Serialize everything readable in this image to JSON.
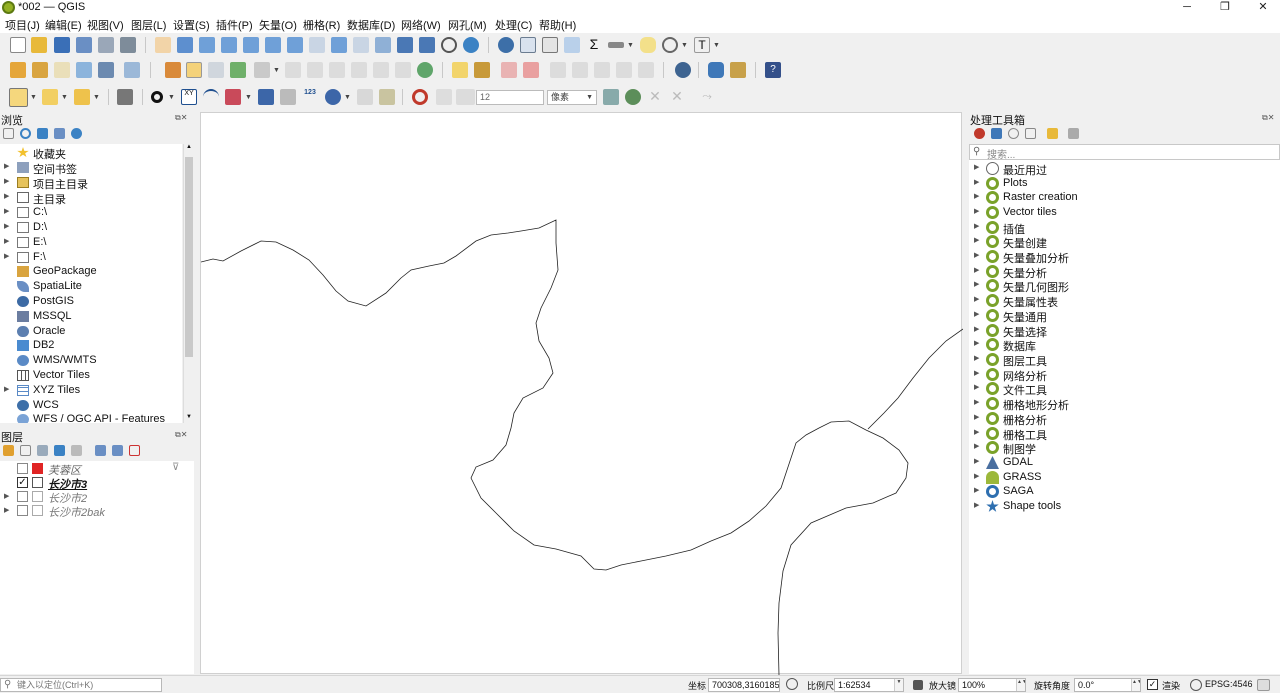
{
  "window": {
    "title": "*002 — QGIS",
    "minimize": "─",
    "maximize": "❐",
    "close": "✕"
  },
  "menu": [
    "项目(J)",
    "编辑(E)",
    "视图(V)",
    "图层(L)",
    "设置(S)",
    "插件(P)",
    "矢量(O)",
    "栅格(R)",
    "数据库(D)",
    "网络(W)",
    "网孔(M)",
    "处理(C)",
    "帮助(H)"
  ],
  "digitize": {
    "font_size": "12",
    "unit": "像素"
  },
  "browser": {
    "title": "浏览",
    "items": [
      {
        "label": "收藏夹",
        "icon": "star-icon",
        "arrow": false
      },
      {
        "label": "空间书签",
        "icon": "bookmark-icon",
        "arrow": true
      },
      {
        "label": "项目主目录",
        "icon": "project-folder-icon",
        "arrow": true
      },
      {
        "label": "主目录",
        "icon": "home-folder-icon",
        "arrow": true
      },
      {
        "label": "C:\\",
        "icon": "drive-icon",
        "arrow": true
      },
      {
        "label": "D:\\",
        "icon": "drive-icon",
        "arrow": true
      },
      {
        "label": "E:\\",
        "icon": "drive-icon",
        "arrow": true
      },
      {
        "label": "F:\\",
        "icon": "drive-icon",
        "arrow": true
      },
      {
        "label": "GeoPackage",
        "icon": "geopackage-icon",
        "arrow": false
      },
      {
        "label": "SpatiaLite",
        "icon": "spatialite-icon",
        "arrow": false
      },
      {
        "label": "PostGIS",
        "icon": "postgis-icon",
        "arrow": false
      },
      {
        "label": "MSSQL",
        "icon": "mssql-icon",
        "arrow": false
      },
      {
        "label": "Oracle",
        "icon": "oracle-icon",
        "arrow": false
      },
      {
        "label": "DB2",
        "icon": "db2-icon",
        "arrow": false
      },
      {
        "label": "WMS/WMTS",
        "icon": "wms-icon",
        "arrow": false
      },
      {
        "label": "Vector Tiles",
        "icon": "vector-tiles-icon",
        "arrow": false
      },
      {
        "label": "XYZ Tiles",
        "icon": "xyz-tiles-icon",
        "arrow": true
      },
      {
        "label": "WCS",
        "icon": "wcs-icon",
        "arrow": false
      },
      {
        "label": "WFS / OGC API - Features",
        "icon": "wfs-icon",
        "arrow": false
      }
    ]
  },
  "layers": {
    "title": "图层",
    "items": [
      {
        "label": "芙蓉区",
        "checked": false,
        "bold": false,
        "color": "#e02424",
        "filter": true
      },
      {
        "label": "长沙市3",
        "checked": true,
        "bold": true,
        "color": "",
        "filter": false
      },
      {
        "label": "长沙市2",
        "checked": false,
        "bold": false,
        "color": "",
        "filter": false
      },
      {
        "label": "长沙市2bak",
        "checked": false,
        "bold": false,
        "color": "",
        "filter": false
      }
    ]
  },
  "processing": {
    "title": "处理工具箱",
    "search_placeholder": "搜索...",
    "items": [
      {
        "label": "最近用过",
        "icon": "clock-icon"
      },
      {
        "label": "Plots",
        "icon": "qgis-icon"
      },
      {
        "label": "Raster creation",
        "icon": "qgis-icon"
      },
      {
        "label": "Vector tiles",
        "icon": "qgis-icon"
      },
      {
        "label": "插值",
        "icon": "qgis-icon"
      },
      {
        "label": "矢量创建",
        "icon": "qgis-icon"
      },
      {
        "label": "矢量叠加分析",
        "icon": "qgis-icon"
      },
      {
        "label": "矢量分析",
        "icon": "qgis-icon"
      },
      {
        "label": "矢量几何图形",
        "icon": "qgis-icon"
      },
      {
        "label": "矢量属性表",
        "icon": "qgis-icon"
      },
      {
        "label": "矢量通用",
        "icon": "qgis-icon"
      },
      {
        "label": "矢量选择",
        "icon": "qgis-icon"
      },
      {
        "label": "数据库",
        "icon": "qgis-icon"
      },
      {
        "label": "图层工具",
        "icon": "qgis-icon"
      },
      {
        "label": "网络分析",
        "icon": "qgis-icon"
      },
      {
        "label": "文件工具",
        "icon": "qgis-icon"
      },
      {
        "label": "栅格地形分析",
        "icon": "qgis-icon"
      },
      {
        "label": "栅格分析",
        "icon": "qgis-icon"
      },
      {
        "label": "栅格工具",
        "icon": "qgis-icon"
      },
      {
        "label": "制图学",
        "icon": "qgis-icon"
      },
      {
        "label": "GDAL",
        "icon": "gdal-icon"
      },
      {
        "label": "GRASS",
        "icon": "grass-icon"
      },
      {
        "label": "SAGA",
        "icon": "saga-icon"
      },
      {
        "label": "Shape tools",
        "icon": "shape-tools-icon"
      }
    ]
  },
  "status": {
    "locator_placeholder": "键入以定位(Ctrl+K)",
    "coord_label": "坐标",
    "coord_value": "700308,3160185",
    "scale_label": "比例尺",
    "scale_value": "1:62534",
    "magnifier_label": "放大镜",
    "magnifier_value": "100%",
    "rotation_label": "旋转角度",
    "rotation_value": "0.0°",
    "render_label": "渲染",
    "crs": "EPSG:4546"
  }
}
